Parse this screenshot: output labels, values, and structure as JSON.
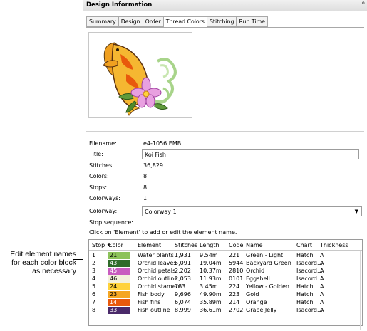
{
  "annotation": {
    "lines": [
      "Edit element names",
      "for each color block",
      "as necessary"
    ]
  },
  "panel": {
    "title": "Design Information",
    "pin_glyph": "⫯"
  },
  "tabs": [
    {
      "label": "Summary",
      "active": false
    },
    {
      "label": "Design",
      "active": false
    },
    {
      "label": "Order",
      "active": false
    },
    {
      "label": "Thread Colors",
      "active": true
    },
    {
      "label": "Stitching",
      "active": false
    },
    {
      "label": "Run Time",
      "active": false
    }
  ],
  "info": {
    "filename_label": "Filename:",
    "filename": "e4-1056.EMB",
    "title_label": "Title:",
    "title": "Koi Fish",
    "stitches_label": "Stitches:",
    "stitches": "36,829",
    "colors_label": "Colors:",
    "colors": "8",
    "stops_label": "Stops:",
    "stops": "8",
    "colorways_label": "Colorways:",
    "colorways": "1",
    "colorway_label": "Colorway:",
    "colorway": "Colorway 1",
    "stop_sequence_label": "Stop sequence:",
    "hint": "Click on 'Element' to add or edit the element name."
  },
  "table": {
    "headers": [
      "Stop #",
      "Color",
      "Element",
      "Stitches",
      "Length",
      "Code",
      "Name",
      "Chart",
      "Thickness"
    ],
    "rows": [
      {
        "stop": "1",
        "color_num": "21",
        "color": "#8cc25a",
        "element": "Water plants",
        "stitches": "1,931",
        "length": "9.54m",
        "code": "221",
        "name": "Green - Light",
        "chart": "Hatch",
        "thickness": "A"
      },
      {
        "stop": "2",
        "color_num": "43",
        "color": "#2f6b2a",
        "element": "Orchid leaves",
        "stitches": "5,091",
        "length": "19.04m",
        "code": "5944",
        "name": "Backyard Green",
        "chart": "Isacord...",
        "thickness": "A"
      },
      {
        "stop": "3",
        "color_num": "45",
        "color": "#c85cc0",
        "element": "Orchid petals",
        "stitches": "2,202",
        "length": "10.37m",
        "code": "2810",
        "name": "Orchid",
        "chart": "Isacord...",
        "thickness": "A"
      },
      {
        "stop": "4",
        "color_num": "46",
        "color": "#f3f1dc",
        "element": "Orchid outline",
        "stitches": "2,053",
        "length": "11.93m",
        "code": "0101",
        "name": "Eggshell",
        "chart": "Isacord...",
        "thickness": "A"
      },
      {
        "stop": "5",
        "color_num": "24",
        "color": "#ffd23a",
        "element": "Orchid stamen",
        "stitches": "783",
        "length": "3.45m",
        "code": "224",
        "name": "Yellow - Golden",
        "chart": "Hatch",
        "thickness": "A"
      },
      {
        "stop": "6",
        "color_num": "23",
        "color": "#f5a623",
        "element": "Fish body",
        "stitches": "9,696",
        "length": "49.90m",
        "code": "223",
        "name": "Gold",
        "chart": "Hatch",
        "thickness": "A"
      },
      {
        "stop": "7",
        "color_num": "14",
        "color": "#e8590c",
        "element": "Fish fins",
        "stitches": "6,074",
        "length": "35.89m",
        "code": "214",
        "name": "Orange",
        "chart": "Hatch",
        "thickness": "A"
      },
      {
        "stop": "8",
        "color_num": "33",
        "color": "#4a2a6a",
        "element": "Fish outline",
        "stitches": "8,999",
        "length": "36.61m",
        "code": "2702",
        "name": "Grape Jelly",
        "chart": "Isacord...",
        "thickness": "A"
      }
    ]
  }
}
